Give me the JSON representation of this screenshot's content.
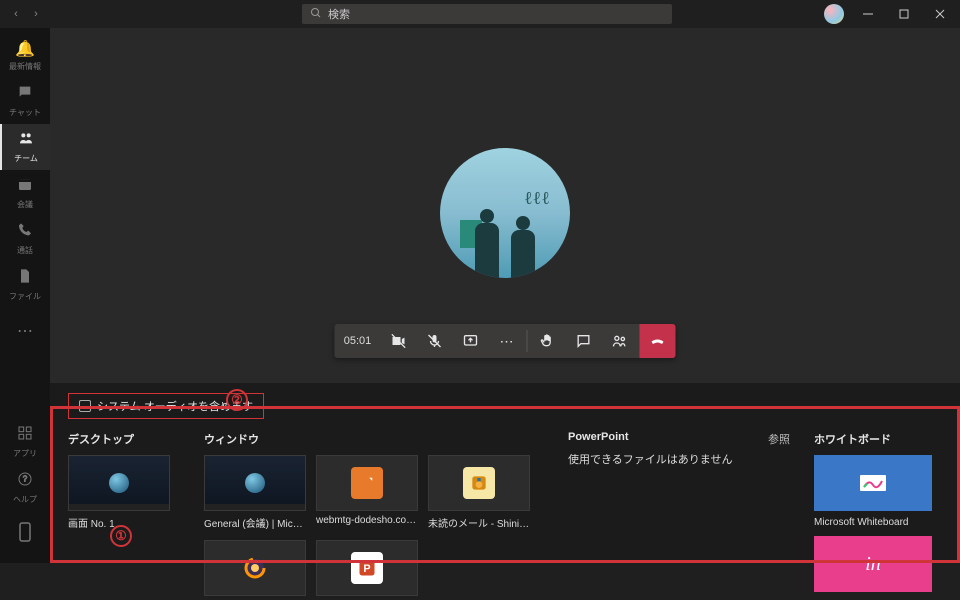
{
  "titlebar": {
    "search_placeholder": "検索"
  },
  "sidebar": {
    "items": [
      {
        "label": "最新情報"
      },
      {
        "label": "チャット"
      },
      {
        "label": "チーム"
      },
      {
        "label": "会議"
      },
      {
        "label": "通話"
      },
      {
        "label": "ファイル"
      },
      {
        "label": ""
      }
    ],
    "bottom": [
      {
        "label": "アプリ"
      },
      {
        "label": "ヘルプ"
      },
      {
        "label": ""
      }
    ]
  },
  "call": {
    "time": "05:01"
  },
  "share": {
    "audio_checkbox_label": "システム オーディオを含めます",
    "annotation1": "①",
    "annotation2": "②",
    "cols": {
      "desktop": "デスクトップ",
      "window": "ウィンドウ",
      "powerpoint": "PowerPoint",
      "browse": "参照",
      "whiteboard": "ホワイトボード"
    },
    "desktop_items": [
      {
        "label": "画面 No. 1"
      }
    ],
    "window_items": [
      {
        "label": "General (会議) | Microsoft..."
      },
      {
        "label": "webmtg-dodesho.com - ..."
      },
      {
        "label": "未読のメール - Shinichi Us..."
      },
      {
        "label": ""
      },
      {
        "label": ""
      }
    ],
    "powerpoint_empty": "使用できるファイルはありません",
    "whiteboard_items": [
      {
        "label": "Microsoft Whiteboard"
      },
      {
        "label": ""
      }
    ]
  }
}
